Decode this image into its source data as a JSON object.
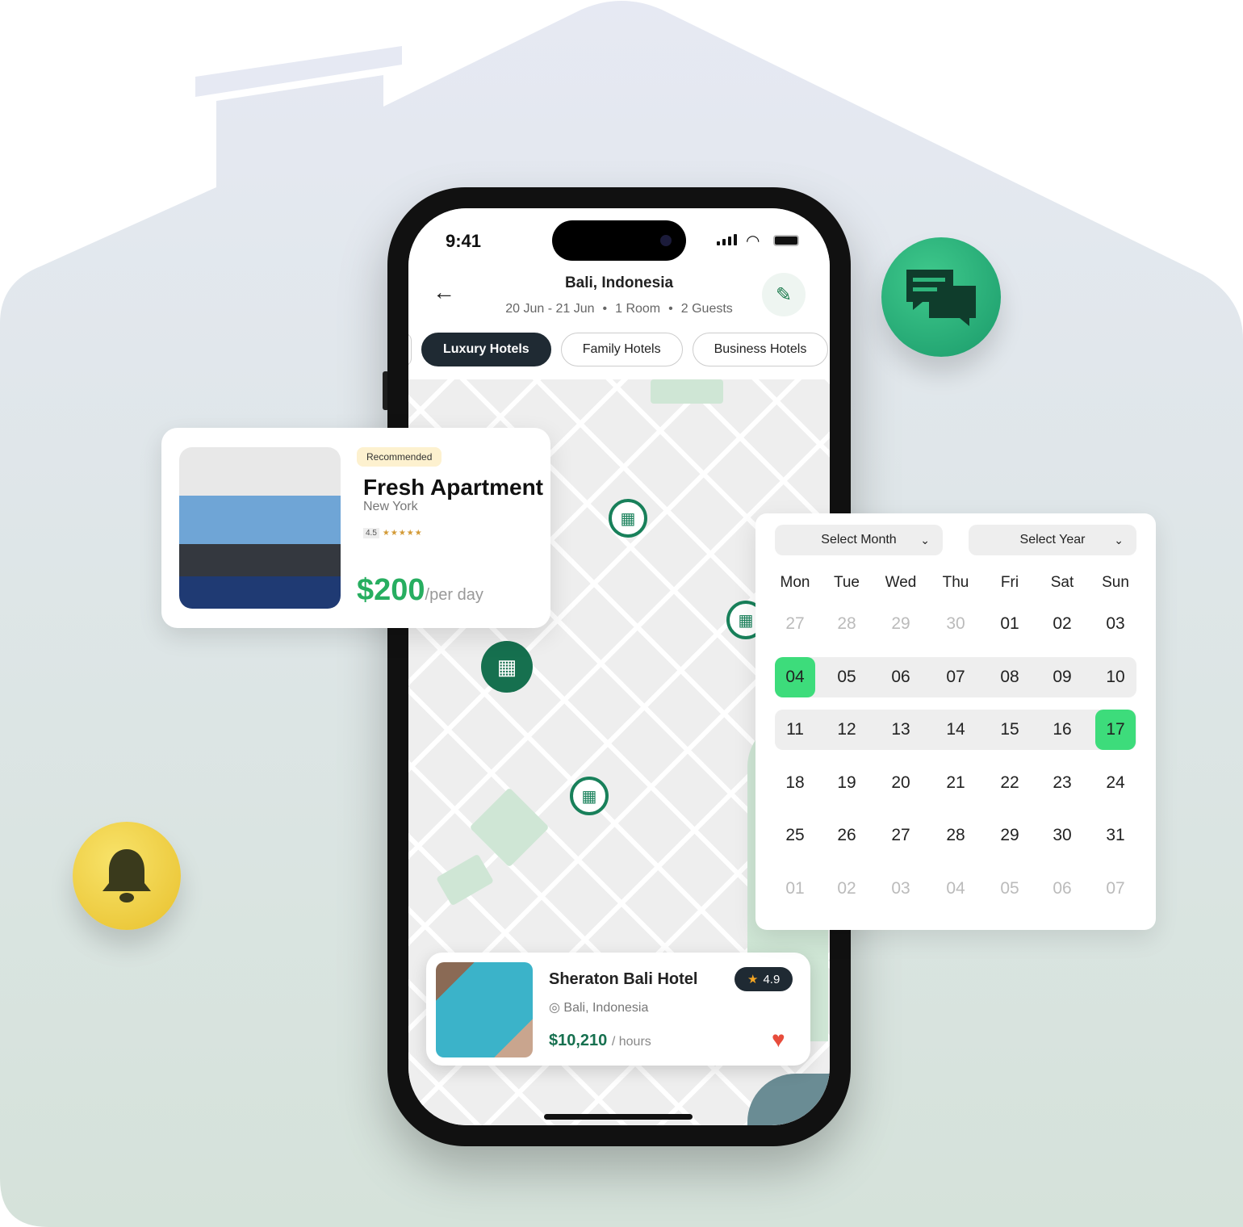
{
  "colors": {
    "brand_green": "#16704f",
    "accent_green": "#3ddc7b",
    "price_green": "#27ae60",
    "dark": "#1f2a33",
    "heart": "#e74c3c",
    "bell": "#f0cf3f"
  },
  "phone": {
    "status": {
      "time": "9:41"
    },
    "header": {
      "title": "Bali, Indonesia",
      "dates": "20 Jun - 21 Jun",
      "rooms": "1 Room",
      "guests": "2 Guests",
      "separator": "•",
      "back_icon": "arrow-left-icon",
      "edit_icon": "pencil-icon"
    },
    "chips": [
      {
        "label": "Luxury Hotels",
        "active": true
      },
      {
        "label": "Family Hotels",
        "active": false
      },
      {
        "label": "Business Hotels",
        "active": false
      }
    ],
    "hotel_card": {
      "name": "Sheraton Bali Hotel",
      "location": "Bali, Indonesia",
      "price": "$10,210",
      "unit": "/ hours",
      "rating": "4.9",
      "favorite": true
    }
  },
  "recommended": {
    "badge": "Recommended",
    "title": "Fresh Apartment",
    "location": "New York",
    "rating": "4.5",
    "stars": "★★★★★",
    "price": "$200",
    "unit": "/per day"
  },
  "calendar": {
    "month_select": "Select Month",
    "year_select": "Select Year",
    "weekdays": [
      "Mon",
      "Tue",
      "Wed",
      "Thu",
      "Fri",
      "Sat",
      "Sun"
    ],
    "weeks": [
      [
        "27",
        "28",
        "29",
        "30",
        "01",
        "02",
        "03"
      ],
      [
        "04",
        "05",
        "06",
        "07",
        "08",
        "09",
        "10"
      ],
      [
        "11",
        "12",
        "13",
        "14",
        "15",
        "16",
        "17"
      ],
      [
        "18",
        "19",
        "20",
        "21",
        "22",
        "23",
        "24"
      ],
      [
        "25",
        "26",
        "27",
        "28",
        "29",
        "30",
        "31"
      ],
      [
        "01",
        "02",
        "03",
        "04",
        "05",
        "06",
        "07"
      ]
    ],
    "muted": [
      [
        0,
        0
      ],
      [
        0,
        1
      ],
      [
        0,
        2
      ],
      [
        0,
        3
      ],
      [
        5,
        0
      ],
      [
        5,
        1
      ],
      [
        5,
        2
      ],
      [
        5,
        3
      ],
      [
        5,
        4
      ],
      [
        5,
        5
      ],
      [
        5,
        6
      ]
    ],
    "selected": [
      [
        1,
        0
      ],
      [
        2,
        6
      ]
    ],
    "range_rows": [
      1,
      2
    ]
  }
}
